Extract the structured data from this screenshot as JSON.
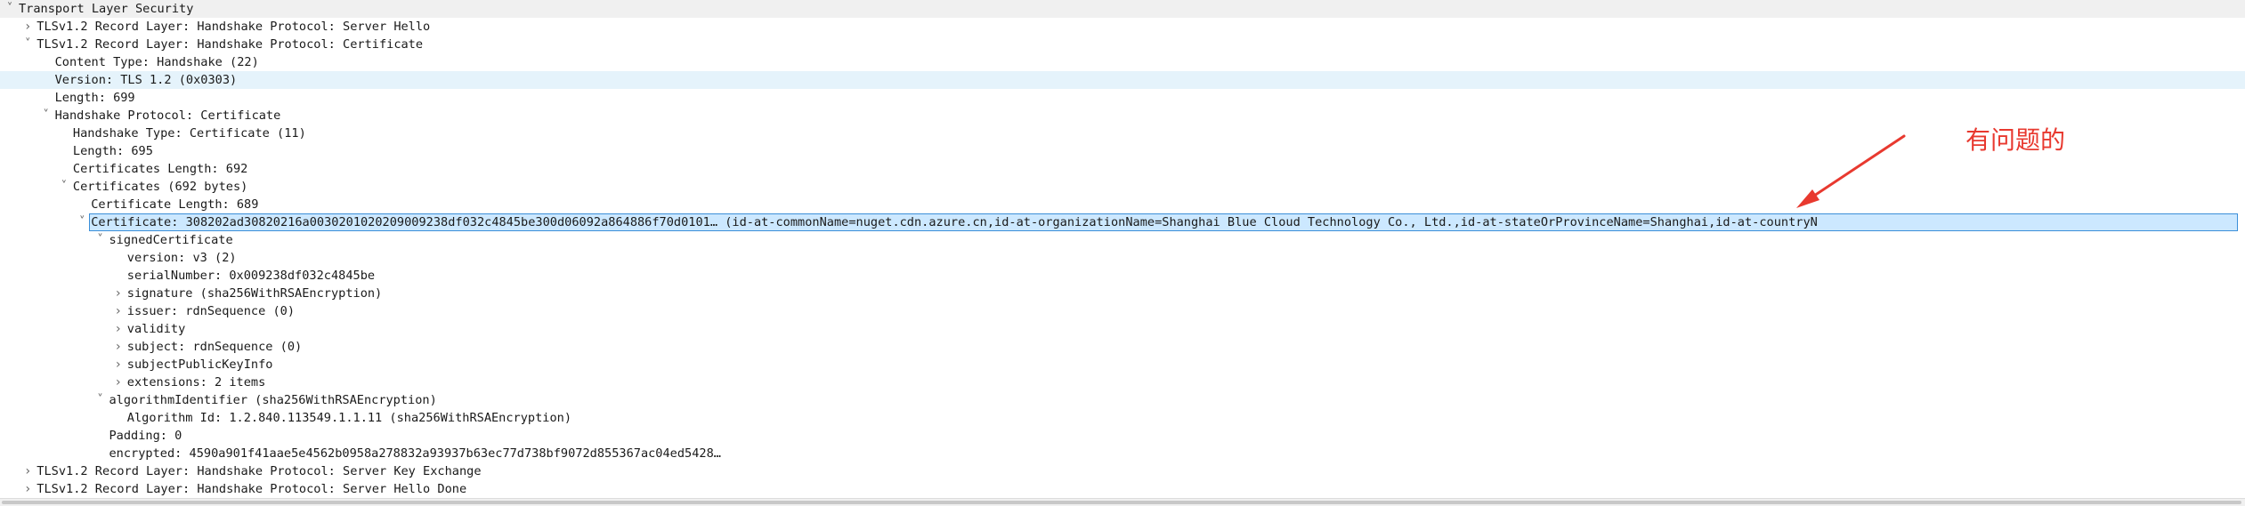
{
  "tree": {
    "rows": [
      {
        "label": "Transport Layer Security",
        "indent": 0,
        "toggle": "expanded"
      },
      {
        "label": "TLSv1.2 Record Layer: Handshake Protocol: Server Hello",
        "indent": 1,
        "toggle": "collapsed"
      },
      {
        "label": "TLSv1.2 Record Layer: Handshake Protocol: Certificate",
        "indent": 1,
        "toggle": "expanded"
      },
      {
        "label": "Content Type: Handshake (22)",
        "indent": 2,
        "toggle": "none"
      },
      {
        "label": "Version: TLS 1.2 (0x0303)",
        "indent": 2,
        "toggle": "none"
      },
      {
        "label": "Length: 699",
        "indent": 2,
        "toggle": "none"
      },
      {
        "label": "Handshake Protocol: Certificate",
        "indent": 2,
        "toggle": "expanded"
      },
      {
        "label": "Handshake Type: Certificate (11)",
        "indent": 3,
        "toggle": "none"
      },
      {
        "label": "Length: 695",
        "indent": 3,
        "toggle": "none"
      },
      {
        "label": "Certificates Length: 692",
        "indent": 3,
        "toggle": "none"
      },
      {
        "label": "Certificates (692 bytes)",
        "indent": 3,
        "toggle": "expanded"
      },
      {
        "label": "Certificate Length: 689",
        "indent": 4,
        "toggle": "none"
      },
      {
        "label": "Certificate: 308202ad30820216a003020102020900923 8df032c4845be300d06092a864886f70d0101… (id-at-commonName=nuget.cdn.azure.cn,id-at-organizationName=Shanghai Blue Cloud Technology Co., Ltd.,id-at-stateOrProvinceName=Shanghai,id-at-countryN",
        "indent": 4,
        "toggle": "expanded"
      },
      {
        "label": "signedCertificate",
        "indent": 5,
        "toggle": "expanded"
      },
      {
        "label": "version: v3 (2)",
        "indent": 6,
        "toggle": "none"
      },
      {
        "label": "serialNumber: 0x009238df032c4845be",
        "indent": 6,
        "toggle": "none"
      },
      {
        "label": "signature (sha256WithRSAEncryption)",
        "indent": 6,
        "toggle": "collapsed"
      },
      {
        "label": "issuer: rdnSequence (0)",
        "indent": 6,
        "toggle": "collapsed"
      },
      {
        "label": "validity",
        "indent": 6,
        "toggle": "collapsed"
      },
      {
        "label": "subject: rdnSequence (0)",
        "indent": 6,
        "toggle": "collapsed"
      },
      {
        "label": "subjectPublicKeyInfo",
        "indent": 6,
        "toggle": "collapsed"
      },
      {
        "label": "extensions: 2 items",
        "indent": 6,
        "toggle": "collapsed"
      },
      {
        "label": "algorithmIdentifier (sha256WithRSAEncryption)",
        "indent": 5,
        "toggle": "expanded"
      },
      {
        "label": "Algorithm Id: 1.2.840.113549.1.1.11 (sha256WithRSAEncryption)",
        "indent": 6,
        "toggle": "none"
      },
      {
        "label": "Padding: 0",
        "indent": 5,
        "toggle": "none"
      },
      {
        "label": "encrypted: 4590a901f41aae5e4562b0958a278832a93937b63ec77d738bf9072d855367ac04ed5428…",
        "indent": 5,
        "toggle": "none"
      },
      {
        "label": "TLSv1.2 Record Layer: Handshake Protocol: Server Key Exchange",
        "indent": 1,
        "toggle": "collapsed"
      },
      {
        "label": "TLSv1.2 Record Layer: Handshake Protocol: Server Hello Done",
        "indent": 1,
        "toggle": "collapsed"
      }
    ],
    "selected_index": 12,
    "hover_index": 4
  },
  "annotation": {
    "text": "有问题的",
    "color": "#e8392f"
  },
  "colors": {
    "selection_bg": "#cce8ff",
    "selection_border": "#3b8fd9",
    "hover_bg": "#e5f3fb",
    "header_bg": "#f0f0f0"
  },
  "icons": {
    "expanded": "chevron-down-icon",
    "collapsed": "chevron-right-icon"
  }
}
